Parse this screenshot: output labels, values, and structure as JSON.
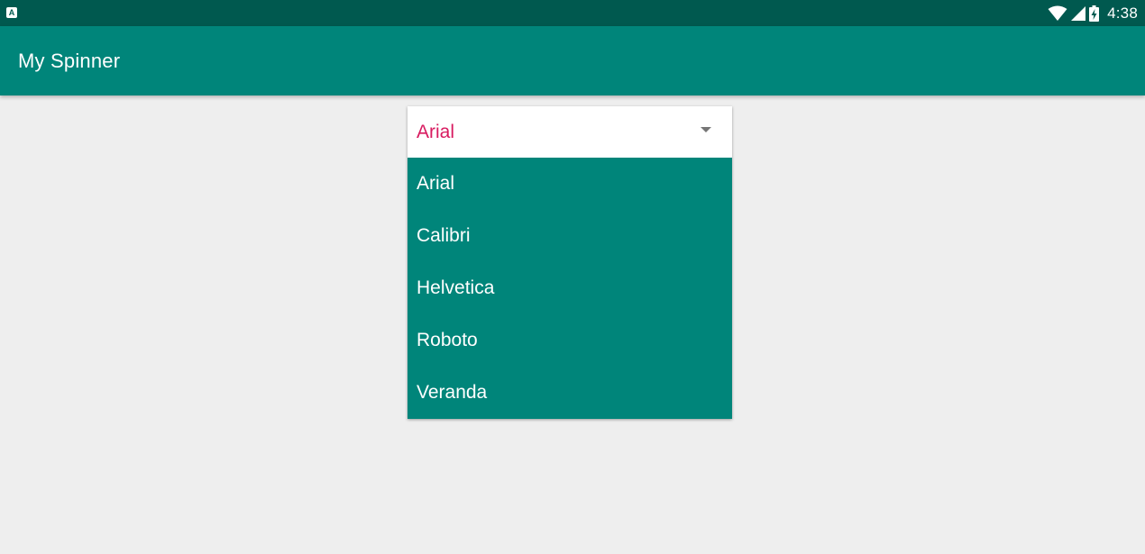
{
  "status_bar": {
    "notification_icon": "android-notification-icon",
    "notification_glyph": "A",
    "wifi_icon": "wifi-icon",
    "signal_icon": "cell-signal-icon",
    "battery_icon": "battery-charging-icon",
    "time": "4:38"
  },
  "app_bar": {
    "title": "My Spinner"
  },
  "spinner": {
    "selected": "Arial",
    "arrow_icon": "dropdown-arrow-icon",
    "options": [
      "Arial",
      "Calibri",
      "Helvetica",
      "Roboto",
      "Veranda"
    ]
  },
  "colors": {
    "status_bar": "#00594f",
    "app_bar": "#00857a",
    "dropdown_bg": "#00857a",
    "selected_text": "#d81b60",
    "background": "#eeeeee"
  }
}
